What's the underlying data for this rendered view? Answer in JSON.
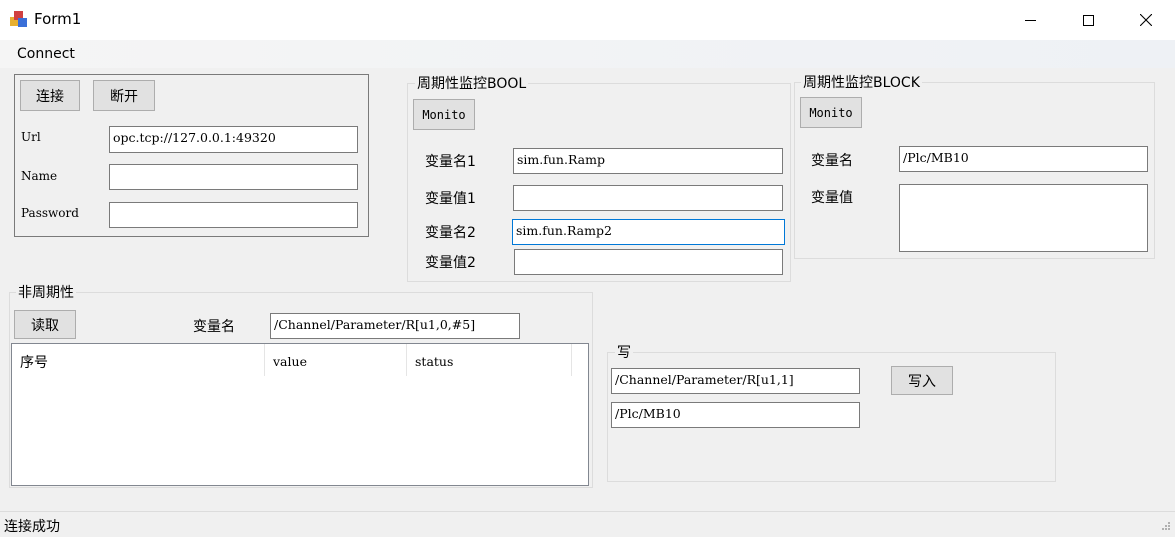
{
  "window": {
    "title": "Form1",
    "min_glyph": "—",
    "max_glyph": "☐",
    "close_glyph": "✕"
  },
  "menu": {
    "connect": "Connect"
  },
  "connect_group": {
    "connect_button": "连接",
    "disconnect_button": "断开",
    "url_label": "Url",
    "url_value": "opc.tcp://127.0.0.1:49320",
    "name_label": "Name",
    "name_value": "",
    "password_label": "Password",
    "password_value": ""
  },
  "bool_group": {
    "title": "周期性监控BOOL",
    "monitor_button": "Monito",
    "var_name1_label": "变量名1",
    "var_name1_value": "sim.fun.Ramp",
    "var_value1_label": "变量值1",
    "var_value1_value": "",
    "var_name2_label": "变量名2",
    "var_name2_value": "sim.fun.Ramp2",
    "var_value2_label": "变量值2",
    "var_value2_value": ""
  },
  "block_group": {
    "title": "周期性监控BLOCK",
    "monitor_button": "Monito",
    "var_name_label": "变量名",
    "var_name_value": "/Plc/MB10",
    "var_value_label": "变量值",
    "var_value_value": ""
  },
  "nonperiodic_group": {
    "title": "非周期性",
    "read_button": "读取",
    "var_name_label": "变量名",
    "var_name_value": "/Channel/Parameter/R[u1,0,#5]",
    "columns": [
      "序号",
      "value",
      "status"
    ]
  },
  "write_group": {
    "title": "写",
    "path_value": "/Channel/Parameter/R[u1,1]",
    "value_value": "/Plc/MB10",
    "write_button": "写入"
  },
  "status": {
    "text": "连接成功"
  }
}
